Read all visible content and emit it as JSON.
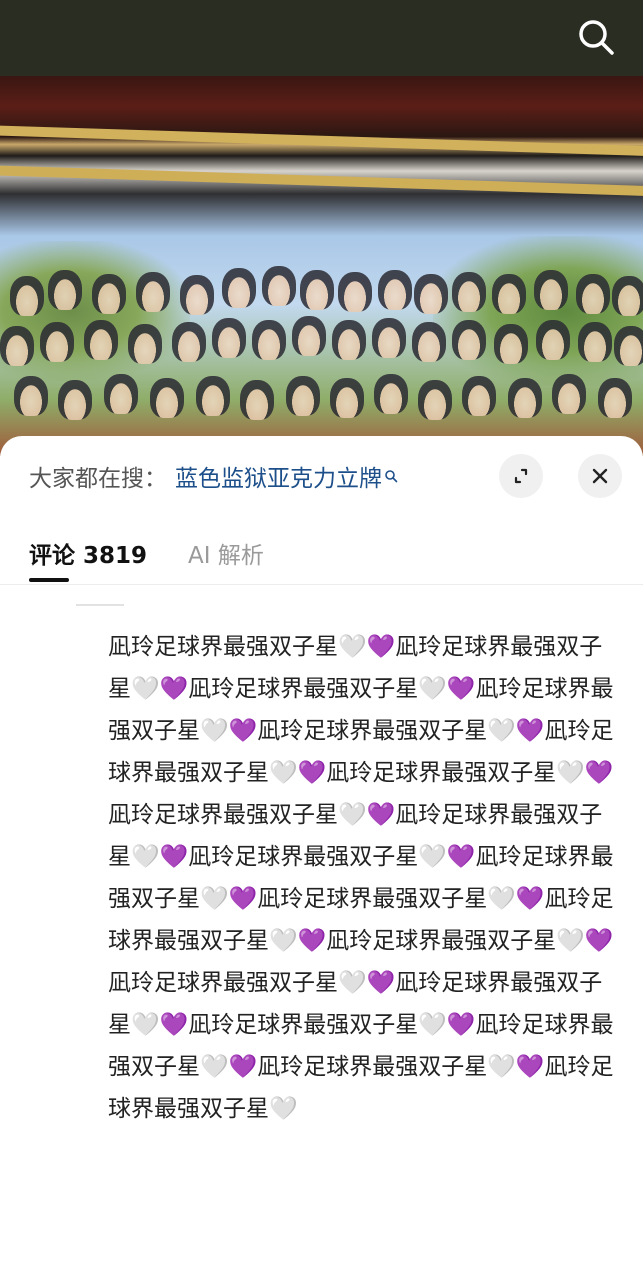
{
  "header": {
    "search_icon": "search-icon"
  },
  "sheet": {
    "suggest": {
      "label": "大家都在搜：",
      "term": "蓝色监狱亚克力立牌",
      "term_icon": "search-small-icon"
    },
    "expand_icon": "expand-arrows-icon",
    "close_icon": "close-icon",
    "tabs": [
      {
        "label": "评论 3819",
        "active": true
      },
      {
        "label": "AI 解析",
        "active": false
      }
    ],
    "comment_text": "凪玲足球界最强双子星🤍💜凪玲足球界最强双子星🤍💜凪玲足球界最强双子星🤍💜凪玲足球界最强双子星🤍💜凪玲足球界最强双子星🤍💜凪玲足球界最强双子星🤍💜凪玲足球界最强双子星🤍💜凪玲足球界最强双子星🤍💜凪玲足球界最强双子星🤍💜凪玲足球界最强双子星🤍💜凪玲足球界最强双子星🤍💜凪玲足球界最强双子星🤍💜凪玲足球界最强双子星🤍💜凪玲足球界最强双子星🤍💜凪玲足球界最强双子星🤍💜凪玲足球界最强双子星🤍💜凪玲足球界最强双子星🤍💜凪玲足球界最强双子星🤍💜凪玲足球界最强双子星🤍💜凪玲足球界最强双子星🤍"
  },
  "colors": {
    "topbar": "#2a2d22",
    "link": "#1d4f8a",
    "tab_active": "#111111",
    "tab_inactive": "#9a9a9a"
  }
}
